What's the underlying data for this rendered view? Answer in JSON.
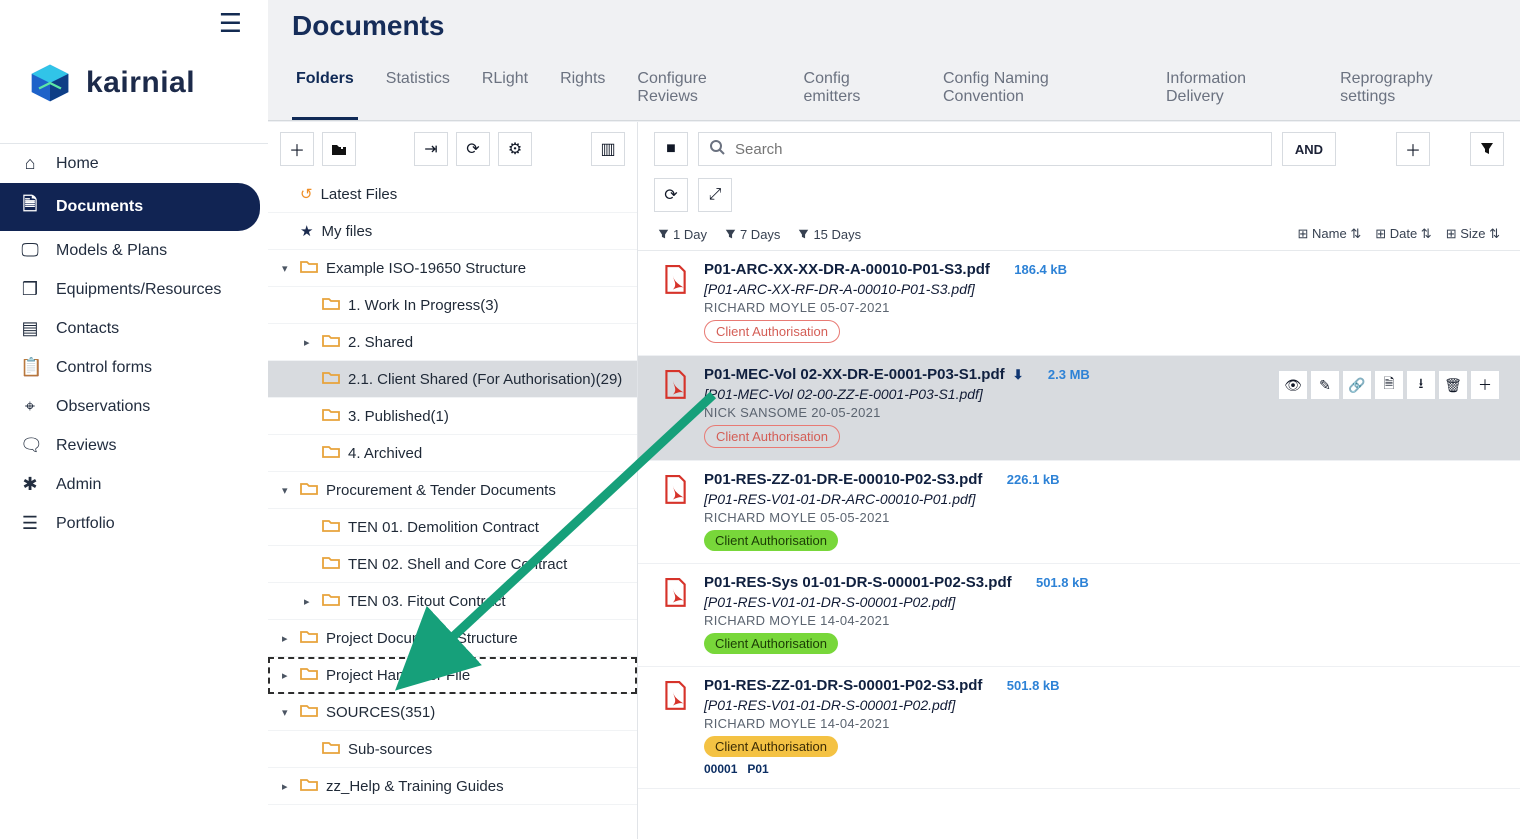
{
  "brand": {
    "name": "kairnial"
  },
  "page": {
    "title": "Documents"
  },
  "nav": [
    {
      "label": "Home",
      "icon": "home",
      "active": false
    },
    {
      "label": "Documents",
      "icon": "doc",
      "active": true
    },
    {
      "label": "Models & Plans",
      "icon": "monitor",
      "active": false
    },
    {
      "label": "Equipments/Resources",
      "icon": "box",
      "active": false
    },
    {
      "label": "Contacts",
      "icon": "page",
      "active": false
    },
    {
      "label": "Control forms",
      "icon": "clipboard",
      "active": false
    },
    {
      "label": "Observations",
      "icon": "pin",
      "active": false
    },
    {
      "label": "Reviews",
      "icon": "chat",
      "active": false
    },
    {
      "label": "Admin",
      "icon": "asterisk",
      "active": false
    },
    {
      "label": "Portfolio",
      "icon": "list",
      "active": false
    }
  ],
  "tabs": [
    {
      "label": "Folders",
      "active": true
    },
    {
      "label": "Statistics"
    },
    {
      "label": "RLight"
    },
    {
      "label": "Rights"
    },
    {
      "label": "Configure Reviews"
    },
    {
      "label": "Config emitters"
    },
    {
      "label": "Config Naming Convention"
    },
    {
      "label": "Information Delivery"
    },
    {
      "label": "Reprography settings"
    }
  ],
  "tree": [
    {
      "label": "Latest Files",
      "kind": "latest"
    },
    {
      "label": "My files",
      "kind": "star"
    },
    {
      "label": "Example ISO-19650 Structure",
      "kind": "folder",
      "caret": "down",
      "depth": 0
    },
    {
      "label": "1. Work In Progress(3)",
      "kind": "folder",
      "depth": 1
    },
    {
      "label": "2. Shared",
      "kind": "folder",
      "caret": "right",
      "depth": 1
    },
    {
      "label": "2.1. Client Shared (For Authorisation)(29)",
      "kind": "folder",
      "depth": 1,
      "selected": true
    },
    {
      "label": "3. Published(1)",
      "kind": "folder",
      "depth": 1
    },
    {
      "label": "4. Archived",
      "kind": "folder",
      "depth": 1
    },
    {
      "label": "Procurement & Tender Documents",
      "kind": "folder",
      "caret": "down",
      "depth": 0
    },
    {
      "label": "TEN 01. Demolition Contract",
      "kind": "folder",
      "depth": 1
    },
    {
      "label": "TEN 02. Shell and Core Contract",
      "kind": "folder",
      "depth": 1
    },
    {
      "label": "TEN 03. Fitout Contract",
      "kind": "folder",
      "caret": "right",
      "depth": 1
    },
    {
      "label": "Project Documents Structure",
      "kind": "folder",
      "caret": "right",
      "depth": 0
    },
    {
      "label": "Project Handover File",
      "kind": "folder",
      "caret": "right",
      "depth": 0,
      "target": true
    },
    {
      "label": "SOURCES(351)",
      "kind": "folder",
      "caret": "down",
      "depth": 0
    },
    {
      "label": "Sub-sources",
      "kind": "folder",
      "depth": 1
    },
    {
      "label": "zz_Help & Training Guides",
      "kind": "folder",
      "caret": "right",
      "depth": 0
    }
  ],
  "search": {
    "placeholder": "Search",
    "and_label": "AND"
  },
  "day_filters": [
    "1 Day",
    "7 Days",
    "15 Days"
  ],
  "sorts": [
    "Name",
    "Date",
    "Size"
  ],
  "files": [
    {
      "name": "P01-ARC-XX-XX-DR-A-00010-P01-S3.pdf",
      "size": "186.4 kB",
      "ref": "[P01-ARC-XX-RF-DR-A-00010-P01-S3.pdf]",
      "author": "RICHARD MOYLE 05-07-2021",
      "pill": {
        "text": "Client Authorisation",
        "style": "outline"
      }
    },
    {
      "name": "P01-MEC-Vol 02-XX-DR-E-0001-P03-S1.pdf",
      "size": "2.3 MB",
      "ref": "[P01-MEC-Vol 02-00-ZZ-E-0001-P03-S1.pdf]",
      "author": "NICK SANSOME 20-05-2021",
      "pill": {
        "text": "Client Authorisation",
        "style": "outline"
      },
      "hovered": true,
      "download_icon": true
    },
    {
      "name": "P01-RES-ZZ-01-DR-E-00010-P02-S3.pdf",
      "size": "226.1 kB",
      "ref": "[P01-RES-V01-01-DR-ARC-00010-P01.pdf]",
      "author": "RICHARD MOYLE 05-05-2021",
      "pill": {
        "text": "Client Authorisation",
        "style": "green"
      }
    },
    {
      "name": "P01-RES-Sys 01-01-DR-S-00001-P02-S3.pdf",
      "size": "501.8 kB",
      "ref": "[P01-RES-V01-01-DR-S-00001-P02.pdf]",
      "author": "RICHARD MOYLE 14-04-2021",
      "pill": {
        "text": "Client Authorisation",
        "style": "green"
      }
    },
    {
      "name": "P01-RES-ZZ-01-DR-S-00001-P02-S3.pdf",
      "size": "501.8 kB",
      "ref": "[P01-RES-V01-01-DR-S-00001-P02.pdf]",
      "author": "RICHARD MOYLE 14-04-2021",
      "pill": {
        "text": "Client Authorisation",
        "style": "yellow"
      },
      "codes": [
        "00001",
        "P01"
      ]
    }
  ],
  "row_actions": [
    "view",
    "edit",
    "link",
    "file",
    "download",
    "delete",
    "add"
  ]
}
